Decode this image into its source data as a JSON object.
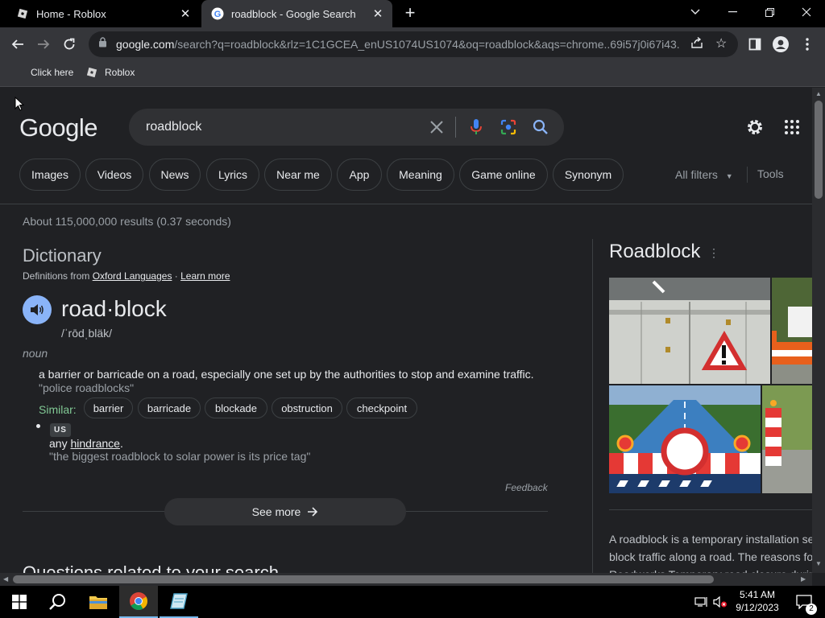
{
  "tabs": [
    {
      "title": "Home - Roblox",
      "active": false
    },
    {
      "title": "roadblock - Google Search",
      "active": true
    }
  ],
  "omnibox": {
    "host": "google.com",
    "path": "/search?q=roadblock&rlz=1C1GCEA_enUS1074US1074&oq=roadblock&aqs=chrome..69i57j0i67i43..."
  },
  "bookmarks": [
    {
      "label": "Click here"
    },
    {
      "label": "Roblox"
    }
  ],
  "search": {
    "logo": "Google",
    "query": "roadblock"
  },
  "chips": [
    "Images",
    "Videos",
    "News",
    "Lyrics",
    "Near me",
    "App",
    "Meaning",
    "Game online",
    "Synonym"
  ],
  "filters": {
    "all_filters": "All filters",
    "tools": "Tools"
  },
  "stats": "About 115,000,000 results (0.37 seconds)",
  "dictionary": {
    "title": "Dictionary",
    "source_prefix": "Definitions from ",
    "source": "Oxford Languages",
    "separator": " · ",
    "learn_more": "Learn more",
    "word": "road·block",
    "phonetic": "/ˈrōdˌbläk/",
    "pos": "noun",
    "definition": "a barrier or barricade on a road, especially one set up by the authorities to stop and examine traffic.",
    "example": "\"police roadblocks\"",
    "similar_label": "Similar:",
    "similar": [
      "barrier",
      "barricade",
      "blockade",
      "obstruction",
      "checkpoint"
    ],
    "region": "US",
    "def2_prefix": "any ",
    "def2_link": "hindrance",
    "def2_suffix": ".",
    "example2": "\"the biggest roadblock to solar power is its price tag\"",
    "feedback": "Feedback",
    "see_more": "See more"
  },
  "questions_heading": "Questions related to your search",
  "knowledge_panel": {
    "title": "Roadblock",
    "description_lines": [
      "A roadblock is a temporary installation se",
      "block traffic along a road. The reasons fo",
      "Roadworks Temporary road closure durin"
    ]
  },
  "taskbar": {
    "time": "5:41 AM",
    "date": "9/12/2023",
    "notifications": "2"
  }
}
